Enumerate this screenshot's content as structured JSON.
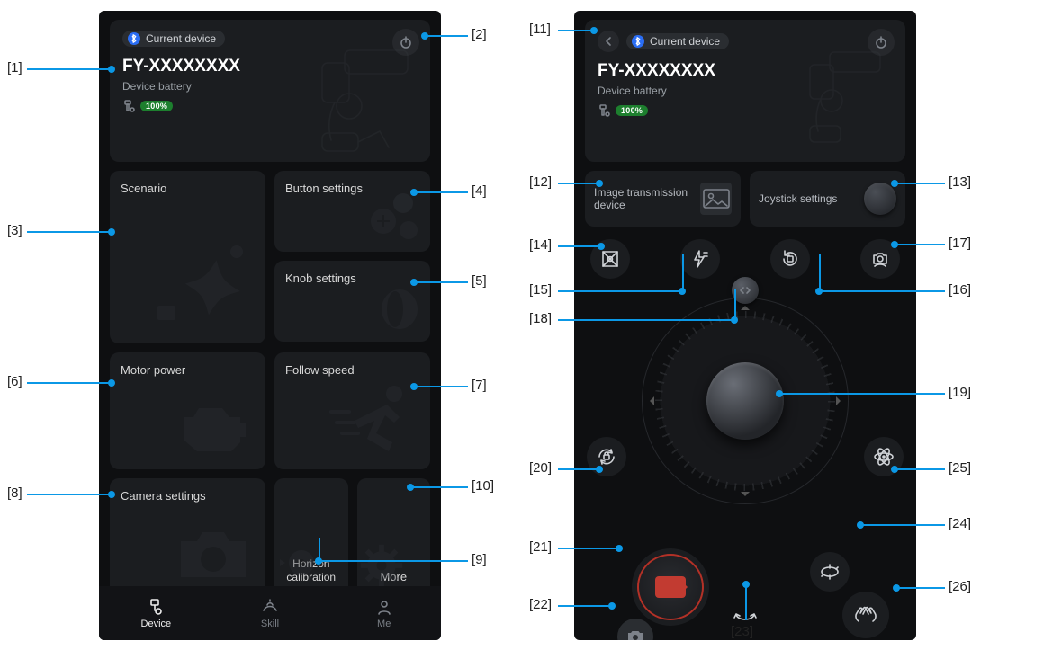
{
  "header": {
    "current_device_label": "Current device",
    "device_name": "FY-XXXXXXXX",
    "battery_label": "Device battery",
    "battery_value": "100%"
  },
  "left": {
    "tiles": {
      "scenario": "Scenario",
      "button_settings": "Button settings",
      "knob_settings": "Knob settings",
      "motor_power": "Motor power",
      "follow_speed": "Follow speed",
      "camera_settings": "Camera settings",
      "horizon_calibration": "Horizon calibration",
      "more": "More"
    },
    "nav": {
      "device": "Device",
      "skill": "Skill",
      "me": "Me"
    }
  },
  "right": {
    "image_tx": "Image transmission device",
    "joystick_settings": "Joystick settings"
  },
  "callouts": {
    "c1": "[1]",
    "c2": "[2]",
    "c3": "[3]",
    "c4": "[4]",
    "c5": "[5]",
    "c6": "[6]",
    "c7": "[7]",
    "c8": "[8]",
    "c9": "[9]",
    "c10": "[10]",
    "c11": "[11]",
    "c12": "[12]",
    "c13": "[13]",
    "c14": "[14]",
    "c15": "[15]",
    "c16": "[16]",
    "c17": "[17]",
    "c18": "[18]",
    "c19": "[19]",
    "c20": "[20]",
    "c21": "[21]",
    "c22": "[22]",
    "c23": "[23]",
    "c24": "[24]",
    "c25": "[25]",
    "c26": "[26]"
  }
}
